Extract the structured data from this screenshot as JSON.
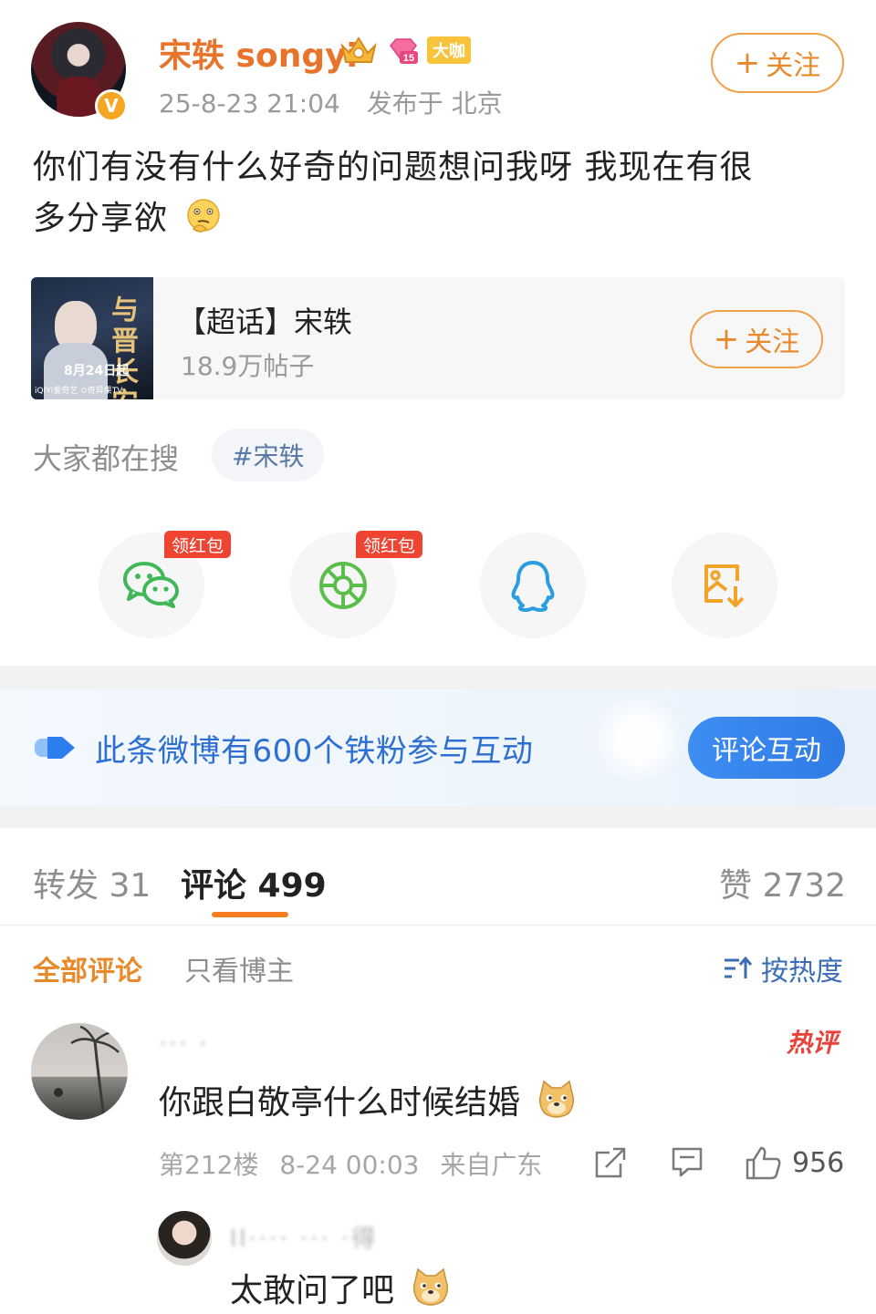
{
  "post": {
    "username": "宋轶 songyi",
    "badges": {
      "crown_icon": "crown-icon",
      "level_badge": "15",
      "tag": "大咖"
    },
    "verified_icon": "v-verified-icon",
    "time": "25-8-23 21:04",
    "location": "发布于 北京",
    "follow_label": "关注",
    "text_line1": "你们有没有什么好奇的问题想问我呀 我现在有很",
    "text_line2": "多分享欲",
    "text_emoji": "thinking-emoji"
  },
  "topic_card": {
    "cover_title": "与晋长安",
    "cover_date": "8月24日起",
    "cover_footer": "iQIYI爱奇艺 ⊙奇异果TV",
    "name": "【超话】宋轶",
    "posts": "18.9万帖子",
    "follow_label": "关注"
  },
  "search": {
    "label": "大家都在搜",
    "tag": "#宋轶"
  },
  "share": {
    "items": [
      {
        "icon": "wechat-icon",
        "tag": "领红包"
      },
      {
        "icon": "moments-icon",
        "tag": "领红包"
      },
      {
        "icon": "qq-icon",
        "tag": ""
      },
      {
        "icon": "save-image-icon",
        "tag": ""
      }
    ]
  },
  "interaction_banner": {
    "text": "此条微博有600个铁粉参与互动",
    "button": "评论互动"
  },
  "tabs": {
    "repost": "转发 31",
    "comment": "评论 499",
    "like": "赞 2732"
  },
  "filters": {
    "all": "全部评论",
    "author_only": "只看博主",
    "sort": "按热度"
  },
  "comment": {
    "name": "··· ·",
    "hot_tag": "热评",
    "text": "你跟白敬亭什么时候结婚",
    "emoji": "doge-emoji",
    "floor": "第212楼",
    "time": "8-24 00:03",
    "location": "来自广东",
    "like_count": "956"
  },
  "reply": {
    "name": "ll···· ··· ·得",
    "text": "太敢问了吧",
    "emoji": "doge-emoji"
  },
  "colors": {
    "accent": "#e88a2c",
    "link": "#2d6fd2",
    "hot": "#e8423a"
  }
}
